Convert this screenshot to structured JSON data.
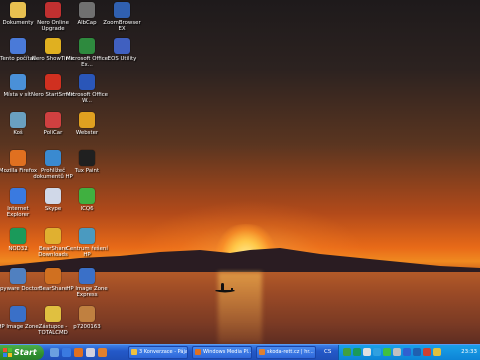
{
  "desktop": {
    "icons": [
      {
        "label": "Dokumenty",
        "icon": "folder-icon",
        "color": "#e8c050"
      },
      {
        "label": "Nero Online Upgrade",
        "icon": "nero-upgrade-icon",
        "color": "#c03030"
      },
      {
        "label": "AlbCap",
        "icon": "albcap-icon",
        "color": "#707070"
      },
      {
        "label": "ZoomBrowser EX",
        "icon": "zoombrowser-icon",
        "color": "#3060b0"
      },
      {
        "label": "Tento počítač",
        "icon": "computer-icon",
        "color": "#4a7ad8"
      },
      {
        "label": "Nero ShowTime",
        "icon": "nero-showtime-icon",
        "color": "#e0b020"
      },
      {
        "label": "Microsoft Office Ex...",
        "icon": "excel-icon",
        "color": "#2e8a3e"
      },
      {
        "label": "EOS Utility",
        "icon": "eos-utility-icon",
        "color": "#4060c0"
      },
      {
        "label": "Místa v síti",
        "icon": "network-places-icon",
        "color": "#4a90d8"
      },
      {
        "label": "Nero StartSmart",
        "icon": "nero-startsmart-icon",
        "color": "#d03020"
      },
      {
        "label": "Microsoft Office W...",
        "icon": "word-icon",
        "color": "#2a56b8"
      },
      {
        "label": "Koš",
        "icon": "recycle-bin-icon",
        "color": "#6aa0c0"
      },
      {
        "label": "PoliCar",
        "icon": "policar-icon",
        "color": "#d04040"
      },
      {
        "label": "Webster",
        "icon": "webster-icon",
        "color": "#e0a020"
      },
      {
        "label": "Mozilla Firefox",
        "icon": "firefox-icon",
        "color": "#e07020"
      },
      {
        "label": "Prohlížeč dokumentů HP",
        "icon": "hp-document-viewer-icon",
        "color": "#3a8ad0"
      },
      {
        "label": "Tux Paint",
        "icon": "tux-paint-icon",
        "color": "#202020"
      },
      {
        "label": "Internet Explorer",
        "icon": "internet-explorer-icon",
        "color": "#3a7ae0"
      },
      {
        "label": "Skype",
        "icon": "skype-icon",
        "color": "#d0d8e8"
      },
      {
        "label": "ICQ6",
        "icon": "icq-icon",
        "color": "#40b040"
      },
      {
        "label": "NOD32",
        "icon": "nod32-icon",
        "color": "#1a9a5a"
      },
      {
        "label": "BearShare Downloads",
        "icon": "bearshare-downloads-icon",
        "color": "#e0b030"
      },
      {
        "label": "Centrum řešení HP",
        "icon": "hp-solution-center-icon",
        "color": "#4a9ac0"
      },
      {
        "label": "Spyware Doctor",
        "icon": "spyware-doctor-icon",
        "color": "#5080c0"
      },
      {
        "label": "BearShare",
        "icon": "bearshare-icon",
        "color": "#d07020"
      },
      {
        "label": "HP Image Zone Express",
        "icon": "hp-image-zone-express-icon",
        "color": "#3a70c8"
      },
      {
        "label": "HP Image Zone",
        "icon": "hp-image-zone-icon",
        "color": "#3a70c8"
      },
      {
        "label": "Zástupce - TOTALCMD",
        "icon": "totalcmd-icon",
        "color": "#e0c040"
      },
      {
        "label": "p7200163",
        "icon": "photo-file-icon",
        "color": "#c08040"
      }
    ]
  },
  "taskbar": {
    "start_label": "Start",
    "quick_launch": [
      {
        "icon": "show-desktop-icon",
        "color": "#6aa0e0"
      },
      {
        "icon": "internet-explorer-icon",
        "color": "#3a7ae0"
      },
      {
        "icon": "media-player-icon",
        "color": "#e07020"
      },
      {
        "icon": "mail-icon",
        "color": "#d0d0e0"
      },
      {
        "icon": "firefox-icon",
        "color": "#e08030"
      }
    ],
    "tasks": [
      {
        "label": "3 Konverzace - Pája",
        "icon": "chat-icon",
        "color": "#f0c040"
      },
      {
        "label": "Windows Media Pl...",
        "icon": "media-player-icon",
        "color": "#e07020"
      },
      {
        "label": "skoda-rett.cz | hr...",
        "icon": "firefox-icon",
        "color": "#e08030"
      }
    ],
    "cs_label": "CS",
    "tray_icons": [
      {
        "icon": "tray-network-icon",
        "color": "#40a040"
      },
      {
        "icon": "tray-antivirus-icon",
        "color": "#1a9a5a"
      },
      {
        "icon": "tray-volume-icon",
        "color": "#e0e0e0"
      },
      {
        "icon": "tray-skype-icon",
        "color": "#30a0e0"
      },
      {
        "icon": "tray-icq-icon",
        "color": "#40c040"
      },
      {
        "icon": "tray-printer-icon",
        "color": "#c0c0c0"
      },
      {
        "icon": "tray-bluetooth-icon",
        "color": "#3060d0"
      },
      {
        "icon": "tray-hp-icon",
        "color": "#2060b0"
      },
      {
        "icon": "tray-security-icon",
        "color": "#d04030"
      },
      {
        "icon": "tray-update-icon",
        "color": "#e0c040"
      }
    ],
    "clock": "23:33"
  }
}
